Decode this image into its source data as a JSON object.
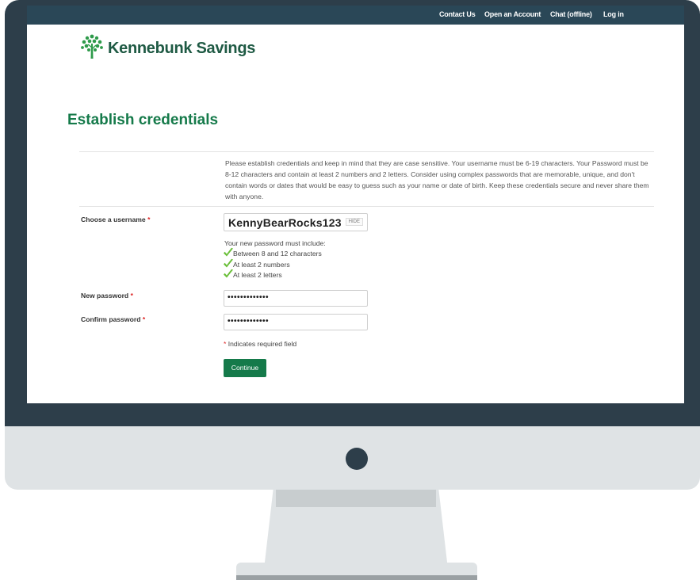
{
  "topnav": {
    "links": [
      "Contact Us",
      "Open an Account",
      "Chat (offline)",
      "Log in"
    ]
  },
  "brand": {
    "name": "Kennebunk Savings",
    "color": "#1f5a44"
  },
  "page": {
    "title": "Establish credentials",
    "intro": "Please establish credentials and keep in mind that they are case sensitive. Your username must be 6-19 characters. Your Password must be 8-12 characters and contain at least 2 numbers and 2 letters. Consider using complex passwords that are memorable, unique, and don't contain words or dates that would be easy to guess such as your name or date of birth. Keep these credentials secure and never share them with anyone."
  },
  "form": {
    "username_label": "Choose a username",
    "username_value": "KennyBearRocks123",
    "hide_label": "HIDE",
    "rules_title": "Your new password must include:",
    "rules": [
      "Between 8 and 12 characters",
      "At least 2 numbers",
      "At least 2 letters"
    ],
    "new_password_label": "New password",
    "new_password_value": "•••••••••••••",
    "confirm_password_label": "Confirm password",
    "confirm_password_value": "•••••••••••••",
    "required_marker": "*",
    "required_note": "Indicates required field",
    "continue_label": "Continue"
  },
  "colors": {
    "accent": "#157a4a",
    "nav_bg": "#2a4757",
    "monitor": "#2d3e4a",
    "check": "#6bbf3a"
  }
}
